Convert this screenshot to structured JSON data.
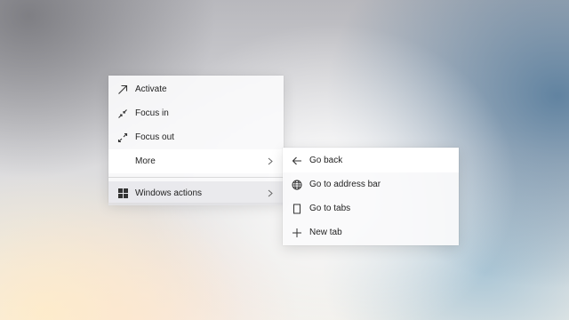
{
  "context_menu": {
    "items": [
      {
        "label": "Activate",
        "icon": "arrow-up-right-icon"
      },
      {
        "label": "Focus in",
        "icon": "focus-in-icon"
      },
      {
        "label": "Focus out",
        "icon": "focus-out-icon"
      },
      {
        "label": "More",
        "icon": "",
        "has_submenu": true,
        "state": "hovered"
      },
      {
        "label": "Windows actions",
        "icon": "windows-logo-icon",
        "has_submenu": true
      }
    ]
  },
  "submenu": {
    "parent": "More",
    "items": [
      {
        "label": "Go back",
        "icon": "back-arrow-icon",
        "state": "hovered"
      },
      {
        "label": "Go to address bar",
        "icon": "globe-icon"
      },
      {
        "label": "Go to tabs",
        "icon": "page-icon"
      },
      {
        "label": "New tab",
        "icon": "plus-icon"
      }
    ]
  },
  "colors": {
    "menu_background": "#fafafb",
    "text": "#1f1f1f",
    "icon": "#333333"
  }
}
